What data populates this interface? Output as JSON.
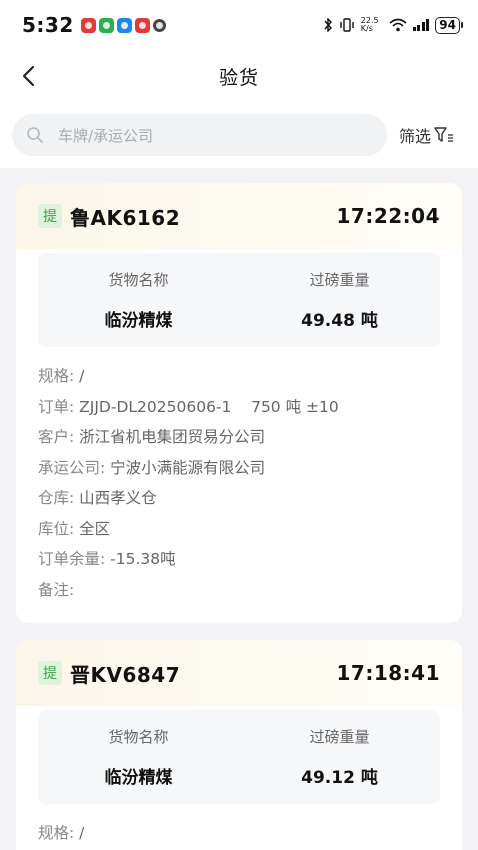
{
  "status_bar": {
    "time": "5:32",
    "network_speed": "22.5 K/s",
    "battery": "94"
  },
  "nav": {
    "title": "验货"
  },
  "search": {
    "placeholder": "车牌/承运公司",
    "filter_label": "筛选"
  },
  "cards": [
    {
      "tag": "提",
      "plate": "鲁AK6162",
      "time": "17:22:04",
      "goods_label": "货物名称",
      "goods_value": "临汾精煤",
      "weight_label": "过磅重量",
      "weight_value": "49.48 吨",
      "spec_label": "规格:",
      "spec_value": "/",
      "order_label": "订单:",
      "order_value": "ZJJD-DL20250606-1    750 吨 ±10",
      "customer_label": "客户:",
      "customer_value": "浙江省机电集团贸易分公司",
      "carrier_label": "承运公司:",
      "carrier_value": "宁波小满能源有限公司",
      "warehouse_label": "仓库:",
      "warehouse_value": "山西孝义仓",
      "location_label": "库位:",
      "location_value": "全区",
      "balance_label": "订单余量:",
      "balance_value": "-15.38吨",
      "remark_label": "备注:",
      "remark_value": ""
    },
    {
      "tag": "提",
      "plate": "晋KV6847",
      "time": "17:18:41",
      "goods_label": "货物名称",
      "goods_value": "临汾精煤",
      "weight_label": "过磅重量",
      "weight_value": "49.12 吨",
      "spec_label": "规格:",
      "spec_value": "/"
    }
  ],
  "colors": {
    "tag_bg": "#dff3dc",
    "tag_text": "#3aa346",
    "card_header": "#fbf6e8"
  }
}
